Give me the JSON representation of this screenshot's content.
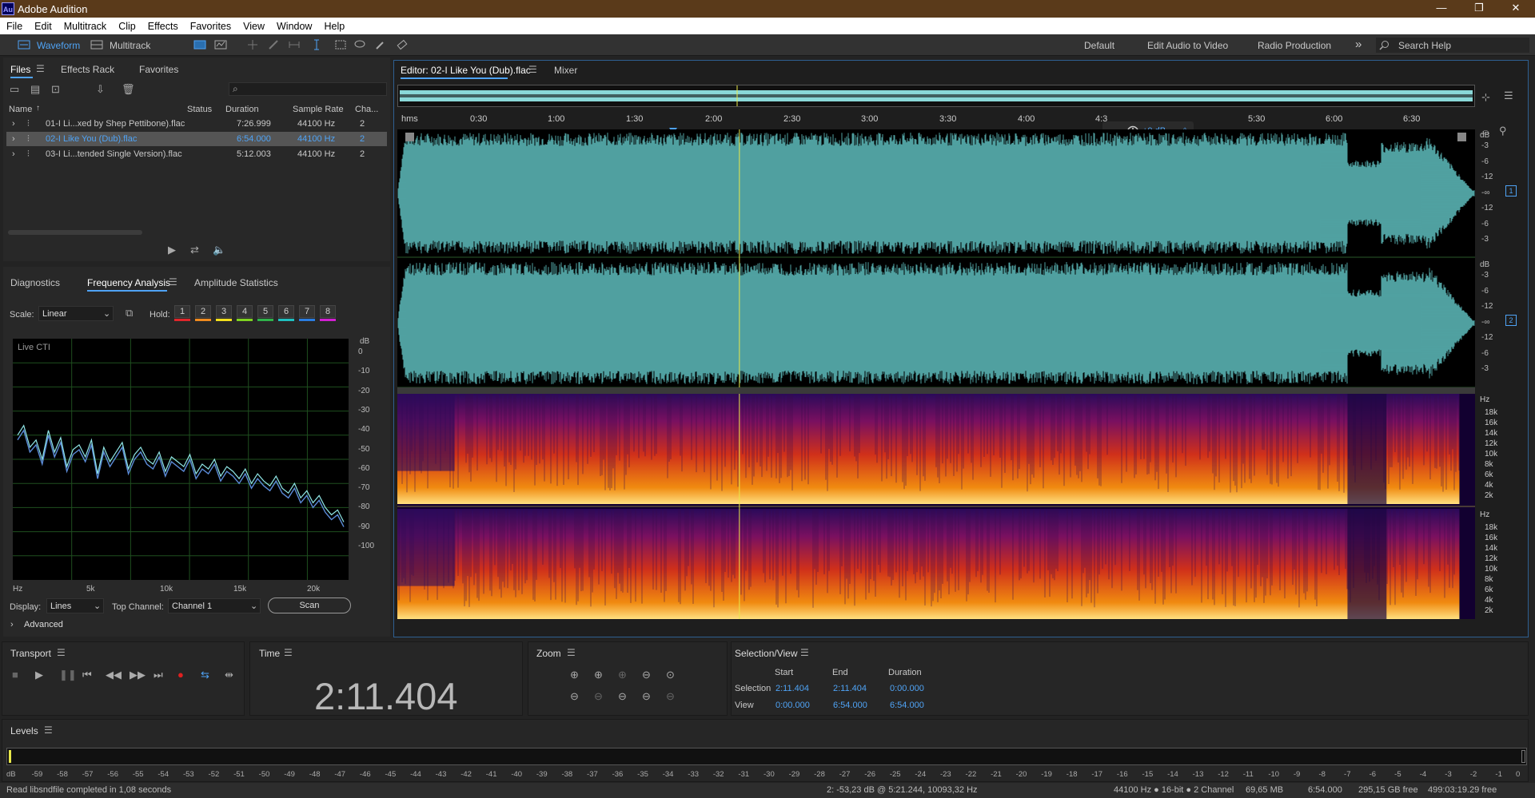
{
  "app": {
    "title": "Adobe Audition",
    "logo": "Au"
  },
  "window_controls": {
    "minimize": "—",
    "restore": "❐",
    "close": "✕"
  },
  "menu": [
    "File",
    "Edit",
    "Multitrack",
    "Clip",
    "Effects",
    "Favorites",
    "View",
    "Window",
    "Help"
  ],
  "toolbar": {
    "waveform": "Waveform",
    "multitrack": "Multitrack",
    "workspaces": [
      "Default",
      "Edit Audio to Video",
      "Radio Production"
    ],
    "more": "»",
    "search_placeholder": "Search Help"
  },
  "files_panel": {
    "tabs": [
      "Files",
      "Effects Rack",
      "Favorites"
    ],
    "columns": [
      "Name",
      "Status",
      "Duration",
      "Sample Rate",
      "Cha..."
    ],
    "rows": [
      {
        "name": "01-I Li...xed by Shep Pettibone).flac",
        "status": "",
        "duration": "7:26.999",
        "rate": "44100 Hz",
        "ch": "2"
      },
      {
        "name": "02-I Like You (Dub).flac",
        "status": "",
        "duration": "6:54.000",
        "rate": "44100 Hz",
        "ch": "2"
      },
      {
        "name": "03-I Li...tended Single Version).flac",
        "status": "",
        "duration": "5:12.003",
        "rate": "44100 Hz",
        "ch": "2"
      }
    ]
  },
  "analysis_panel": {
    "tabs": [
      "Diagnostics",
      "Frequency Analysis",
      "Amplitude Statistics"
    ],
    "scale_label": "Scale:",
    "scale_value": "Linear",
    "hold_label": "Hold:",
    "hold_buttons": [
      "1",
      "2",
      "3",
      "4",
      "5",
      "6",
      "7",
      "8"
    ],
    "hold_colors": [
      "#e0262b",
      "#f08a1e",
      "#f2e01c",
      "#7ed321",
      "#2fb34a",
      "#1fc0c0",
      "#2a7de1",
      "#d21fd2"
    ],
    "graph_label": "Live CTI",
    "db_unit": "dB",
    "db_ticks": [
      "0",
      "-10",
      "-20",
      "-30",
      "-40",
      "-50",
      "-60",
      "-70",
      "-80",
      "-90",
      "-100"
    ],
    "hz_ticks": [
      "Hz",
      "5k",
      "10k",
      "15k",
      "20k"
    ],
    "display_label": "Display:",
    "display_value": "Lines",
    "top_channel_label": "Top Channel:",
    "top_channel_value": "Channel 1",
    "scan_button": "Scan",
    "advanced": "Advanced",
    "spectrum_db": [
      -42,
      -38,
      -47,
      -44,
      -52,
      -40,
      -49,
      -43,
      -55,
      -48,
      -46,
      -51,
      -44,
      -58,
      -47,
      -53,
      -49,
      -45,
      -56,
      -50,
      -47,
      -52,
      -54,
      -49,
      -57,
      -51,
      -53,
      -55,
      -50,
      -58,
      -54,
      -56,
      -52,
      -59,
      -55,
      -57,
      -60,
      -56,
      -62,
      -58,
      -61,
      -63,
      -59,
      -64,
      -66,
      -62,
      -68,
      -65,
      -70,
      -67,
      -72,
      -75,
      -73,
      -78
    ]
  },
  "editor": {
    "tabs": [
      "Editor: 02-I Like You (Dub).flac",
      "Mixer"
    ],
    "ruler_unit": "hms",
    "ruler_labels": [
      "0:30",
      "1:00",
      "1:30",
      "2:00",
      "2:30",
      "3:00",
      "3:30",
      "4:00",
      "4:3",
      "5:30",
      "6:00",
      "6:30"
    ],
    "hud_gain": "+0 dB",
    "playhead_time_s": 131.404,
    "duration_s": 414,
    "db_unit": "dB",
    "db_scale": [
      "-3",
      "-6",
      "-12",
      "-∞",
      "-12",
      "-6",
      "-3"
    ],
    "channel_badges": [
      "1",
      "2"
    ],
    "hz_unit": "Hz",
    "hz_scale": [
      "18k",
      "16k",
      "14k",
      "12k",
      "10k",
      "8k",
      "6k",
      "4k",
      "2k"
    ]
  },
  "transport": {
    "title": "Transport"
  },
  "time_panel": {
    "title": "Time",
    "value": "2:11.404"
  },
  "zoom_panel": {
    "title": "Zoom"
  },
  "selection_panel": {
    "title": "Selection/View",
    "headers": [
      "Start",
      "End",
      "Duration"
    ],
    "selection": {
      "label": "Selection",
      "start": "2:11.404",
      "end": "2:11.404",
      "duration": "0:00.000"
    },
    "view": {
      "label": "View",
      "start": "0:00.000",
      "end": "6:54.000",
      "duration": "6:54.000"
    }
  },
  "levels": {
    "title": "Levels",
    "scale": [
      "dB",
      "-59",
      "-58",
      "-57",
      "-56",
      "-55",
      "-54",
      "-53",
      "-52",
      "-51",
      "-50",
      "-49",
      "-48",
      "-47",
      "-46",
      "-45",
      "-44",
      "-43",
      "-42",
      "-41",
      "-40",
      "-39",
      "-38",
      "-37",
      "-36",
      "-35",
      "-34",
      "-33",
      "-32",
      "-31",
      "-30",
      "-29",
      "-28",
      "-27",
      "-26",
      "-25",
      "-24",
      "-23",
      "-22",
      "-21",
      "-20",
      "-19",
      "-18",
      "-17",
      "-16",
      "-15",
      "-14",
      "-13",
      "-12",
      "-11",
      "-10",
      "-9",
      "-8",
      "-7",
      "-6",
      "-5",
      "-4",
      "-3",
      "-2",
      "-1",
      "0"
    ]
  },
  "status_bar": {
    "message": "Read libsndfile completed in 1,08 seconds",
    "cursor": "2: -53,23 dB @ 5:21.244, 10093,32 Hz",
    "format": "44100 Hz ● 16-bit ● 2 Channel",
    "size": "69,65 MB",
    "duration": "6:54.000",
    "free": "295,15 GB free",
    "free_time": "499:03:19.29 free"
  },
  "colors": {
    "accent": "#4fa3f5",
    "waveform": "#72e6e6",
    "playhead": "#e8e84a",
    "titlebar": "#5a3a1a"
  }
}
